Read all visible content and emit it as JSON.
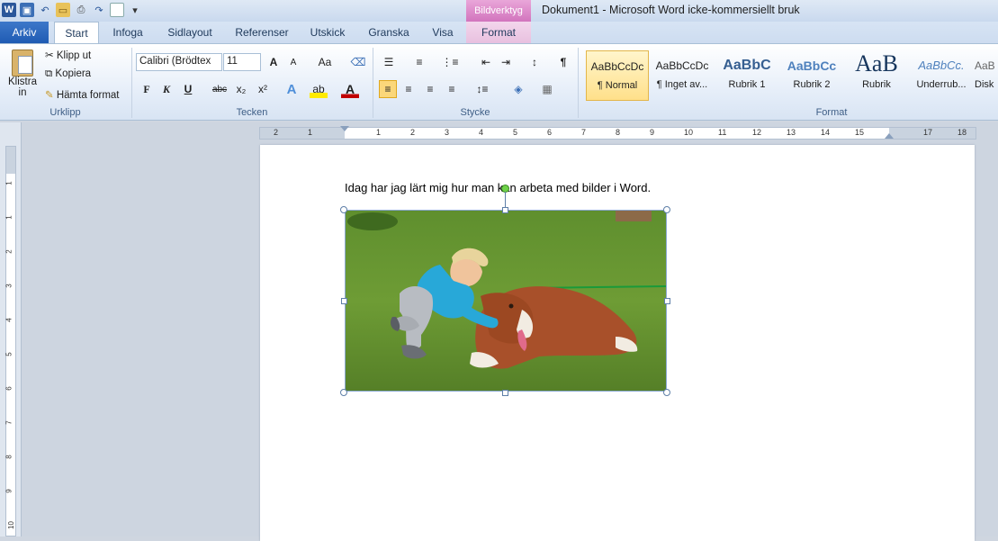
{
  "window": {
    "title": "Dokument1  -  Microsoft Word icke-kommersiellt bruk",
    "context_group": "Bildverktyg"
  },
  "tabs": {
    "file": "Arkiv",
    "start": "Start",
    "insert": "Infoga",
    "layout": "Sidlayout",
    "references": "Referenser",
    "mailings": "Utskick",
    "review": "Granska",
    "view": "Visa",
    "format": "Format"
  },
  "clipboard": {
    "paste": "Klistra",
    "paste2": "in",
    "cut": "Klipp ut",
    "copy": "Kopiera",
    "format_painter": "Hämta format",
    "label": "Urklipp"
  },
  "font": {
    "name": "Calibri (Brödtex",
    "size": "11",
    "bold": "F",
    "italic": "K",
    "underline": "U",
    "strike": "abc",
    "sub": "x₂",
    "sup": "x²",
    "case": "Aa",
    "grow": "A",
    "shrink": "A",
    "label": "Tecken"
  },
  "paragraph": {
    "label": "Stycke",
    "pilcrow": "¶"
  },
  "styles": {
    "label": "Format",
    "items": [
      {
        "sample": "AaBbCcDc",
        "name": "¶ Normal"
      },
      {
        "sample": "AaBbCcDc",
        "name": "¶ Inget av..."
      },
      {
        "sample": "AaBbC",
        "name": "Rubrik 1"
      },
      {
        "sample": "AaBbCc",
        "name": "Rubrik 2"
      },
      {
        "sample": "AaB",
        "name": "Rubrik"
      },
      {
        "sample": "AaBbCc.",
        "name": "Underrub..."
      },
      {
        "sample": "AaB",
        "name": "Disk"
      }
    ]
  },
  "ruler": {
    "h_ticks": [
      "2",
      "1",
      "1",
      "2",
      "3",
      "4",
      "5",
      "6",
      "7",
      "8",
      "9",
      "10",
      "11",
      "12",
      "13",
      "14",
      "15",
      "17",
      "18"
    ],
    "v_ticks": [
      "1",
      "1",
      "2",
      "3",
      "4",
      "5",
      "6",
      "7",
      "8",
      "9",
      "10"
    ]
  },
  "document": {
    "paragraph": "Idag har jag lärt mig hur man kan arbeta med bilder i Word."
  },
  "colors": {
    "accent": "#2b579a",
    "file_tab": "#1f5bb3",
    "context": "#d274bd"
  }
}
